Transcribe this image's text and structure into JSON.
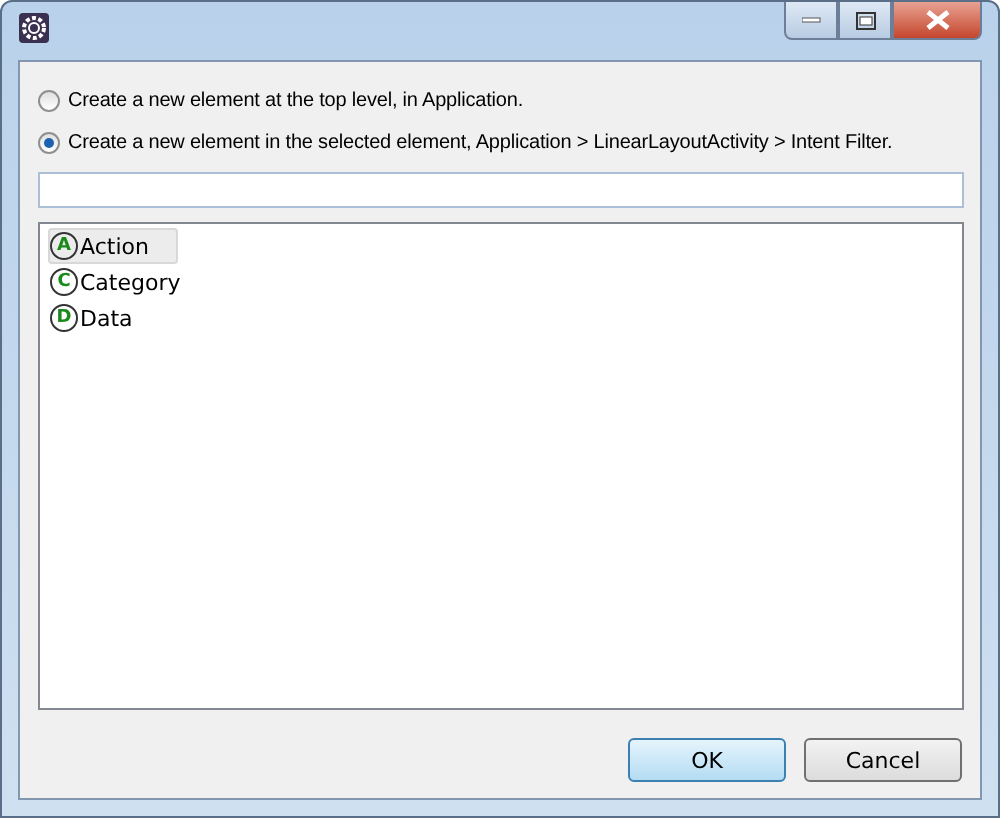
{
  "options": [
    {
      "label": "Create a new element at the top level, in Application.",
      "selected": false
    },
    {
      "label": "Create a new element in the selected element, Application > LinearLayoutActivity > Intent Filter.",
      "selected": true
    }
  ],
  "items": [
    {
      "letter": "A",
      "label": "Action",
      "selected": true
    },
    {
      "letter": "C",
      "label": "Category",
      "selected": false
    },
    {
      "letter": "D",
      "label": "Data",
      "selected": false
    }
  ],
  "buttons": [
    {
      "label": "OK",
      "kind": "default"
    },
    {
      "label": "Cancel",
      "kind": "normal"
    }
  ]
}
